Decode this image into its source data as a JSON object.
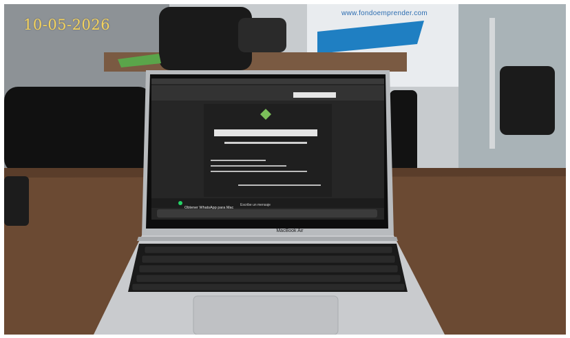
{
  "photo": {
    "date_stamp": "10-05-2026",
    "wall_sign": "www.fondoemprender.com",
    "laptop_brand": "MacBook Air",
    "notification": "Obtener WhatsApp para Mac",
    "chat_placeholder": "Escribe un mensaje"
  },
  "colors": {
    "stamp": "#f4d35e",
    "desk": "#6b4a33",
    "laptop_silver": "#c9cbce",
    "screen_dark": "#262626"
  }
}
